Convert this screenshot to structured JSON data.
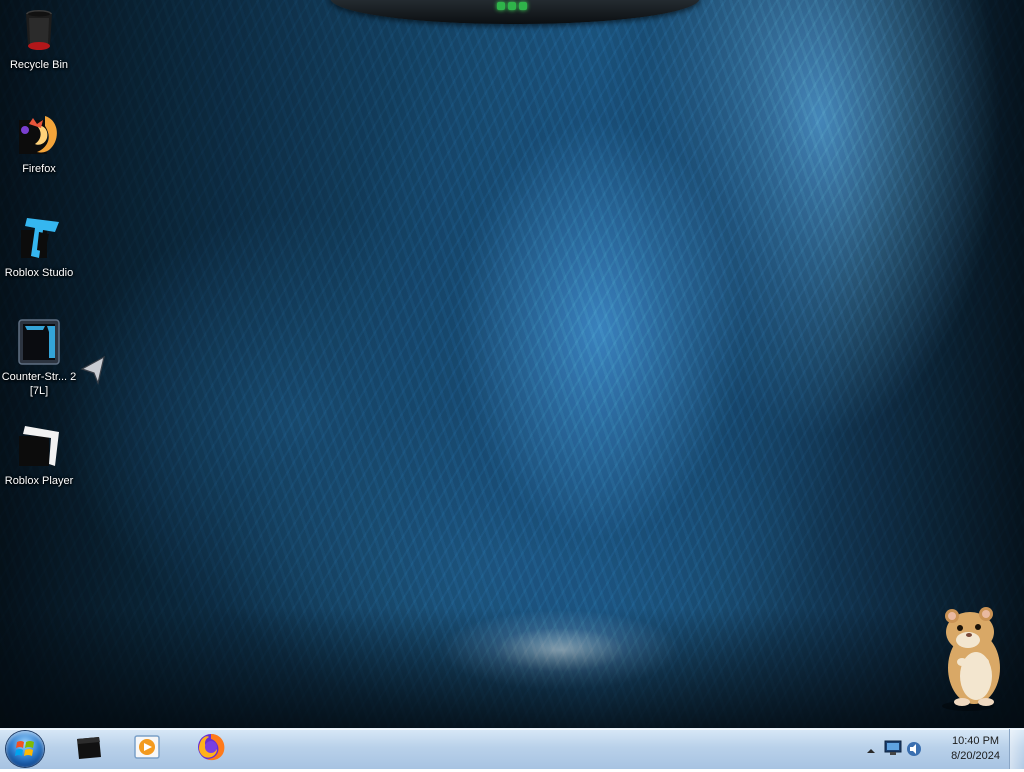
{
  "desktop": {
    "icons": [
      {
        "label": "Recycle Bin",
        "icon": "recycle-bin-icon"
      },
      {
        "label": "Firefox",
        "icon": "firefox-icon"
      },
      {
        "label": "Roblox Studio",
        "icon": "roblox-studio-icon"
      },
      {
        "label": "Counter-Str... 2 [7L]",
        "icon": "counter-strike-icon"
      },
      {
        "label": "Roblox Player",
        "icon": "roblox-player-icon"
      }
    ]
  },
  "taskbar": {
    "pinned": [
      {
        "icon": "terminal-window-icon"
      },
      {
        "icon": "media-player-icon"
      },
      {
        "icon": "firefox-icon"
      }
    ],
    "tray": {
      "time": "10:40 PM",
      "date": "8/20/2024"
    }
  },
  "colors": {
    "taskbar": "#b9d1ea",
    "accent_green": "#2fb34a"
  }
}
